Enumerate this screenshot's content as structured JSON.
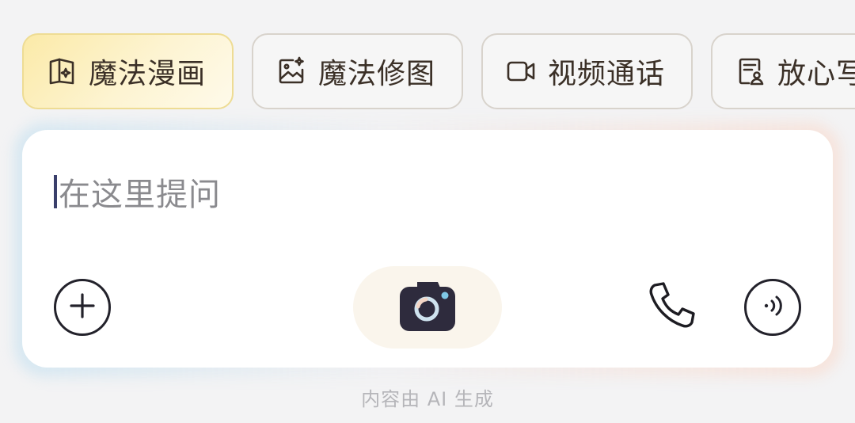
{
  "chips": [
    {
      "label": "魔法漫画",
      "icon": "book-sparkle-icon",
      "active": true
    },
    {
      "label": "魔法修图",
      "icon": "image-sparkle-icon",
      "active": false
    },
    {
      "label": "视频通话",
      "icon": "video-camera-icon",
      "active": false
    },
    {
      "label": "放心写",
      "icon": "document-person-icon",
      "active": false
    }
  ],
  "prompt": {
    "placeholder": "在这里提问"
  },
  "toolbar": {
    "add_icon": "plus-circle-icon",
    "camera_icon": "camera-icon",
    "phone_icon": "phone-icon",
    "voice_icon": "voice-wave-icon"
  },
  "footer": {
    "disclaimer": "内容由 AI 生成"
  },
  "colors": {
    "active_chip_bg": "#fbeaa8",
    "chip_border": "#d8d3cc",
    "text_dark": "#3b3027",
    "camera_pill_bg": "#faf5ec"
  }
}
